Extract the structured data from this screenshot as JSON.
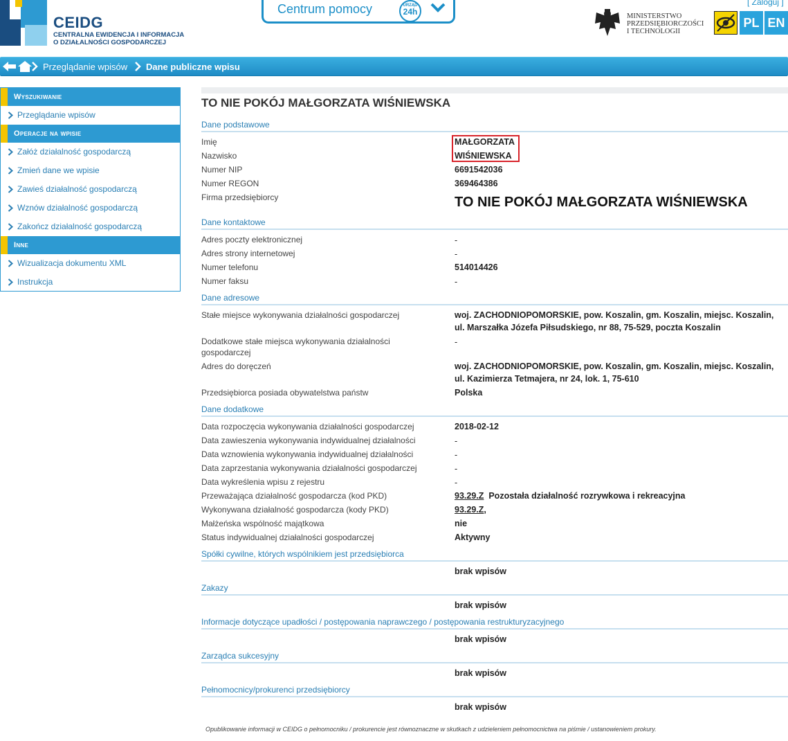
{
  "header": {
    "logo_title": "CEIDG",
    "logo_sub1": "CENTRALNA EWIDENCJA I INFORMACJA",
    "logo_sub2": "O DZIAŁALNOŚCI GOSPODARCZEJ",
    "help_label": "Centrum pomocy",
    "help_badge_top": "URZĄD",
    "help_badge_main": "24h",
    "login": "[ Zaloguj ]",
    "ministry_line1": "MINISTERSTWO",
    "ministry_line2": "PRZEDSIĘBIORCZOŚCI",
    "ministry_line3": "I TECHNOLOGII",
    "lang_pl": "PL",
    "lang_en": "EN"
  },
  "breadcrumb": {
    "item1": "Przeglądanie wpisów",
    "item2": "Dane publiczne wpisu"
  },
  "sidebar": {
    "head1": "Wyszukiwanie",
    "search_items": [
      "Przeglądanie wpisów"
    ],
    "head2": "Operacje na wpisie",
    "op_items": [
      "Załóż działalność gospodarczą",
      "Zmień dane we wpisie",
      "Zawieś działalność gospodarczą",
      "Wznów działalność gospodarczą",
      "Zakończ działalność gospodarczą"
    ],
    "head3": "Inne",
    "other_items": [
      "Wizualizacja dokumentu XML",
      "Instrukcja"
    ]
  },
  "entry": {
    "title": "TO NIE POKÓJ MAŁGORZATA WIŚNIEWSKA",
    "sections": {
      "basic": "Dane podstawowe",
      "contact": "Dane kontaktowe",
      "address": "Dane adresowe",
      "extra": "Dane dodatkowe",
      "partnerships": "Spółki cywilne, których wspólnikiem jest przedsiębiorca",
      "bans": "Zakazy",
      "bankruptcy": "Informacje dotyczące upadłości / postępowania naprawczego / postępowania restrukturyzacyjnego",
      "successor": "Zarządca sukcesyjny",
      "proxies": "Pełnomocnicy/prokurenci przedsiębiorcy"
    },
    "basic": {
      "imie_label": "Imię",
      "imie": "MAŁGORZATA",
      "nazwisko_label": "Nazwisko",
      "nazwisko": "WIŚNIEWSKA",
      "nip_label": "Numer NIP",
      "nip": "6691542036",
      "regon_label": "Numer REGON",
      "regon": "369464386",
      "firma_label": "Firma przedsiębiorcy",
      "firma": "TO NIE POKÓJ MAŁGORZATA WIŚNIEWSKA"
    },
    "contact": {
      "email_label": "Adres poczty elektronicznej",
      "email": "-",
      "www_label": "Adres strony internetowej",
      "www": "-",
      "phone_label": "Numer telefonu",
      "phone": "514014426",
      "fax_label": "Numer faksu",
      "fax": "-"
    },
    "address": {
      "main_label": "Stałe miejsce wykonywania działalności gospodarczej",
      "main_line1": "woj. ZACHODNIOPOMORSKIE, pow. Koszalin, gm. Koszalin, miejsc. Koszalin,",
      "main_line2": "ul. Marszałka Józefa Piłsudskiego, nr 88, 75-529, poczta Koszalin",
      "additional_label_1": "Dodatkowe stałe miejsca wykonywania działalności",
      "additional_label_2": "gospodarczej",
      "additional": "-",
      "delivery_label": "Adres do doręczeń",
      "delivery_line1": "woj. ZACHODNIOPOMORSKIE, pow. Koszalin, gm. Koszalin, miejsc. Koszalin,",
      "delivery_line2": "ul. Kazimierza Tetmajera, nr 24, lok. 1, 75-610",
      "citizenship_label": "Przedsiębiorca posiada obywatelstwa państw",
      "citizenship": "Polska"
    },
    "extra": {
      "start_label": "Data rozpoczęcia wykonywania działalności gospodarczej",
      "start": "2018-02-12",
      "suspend_label": "Data zawieszenia wykonywania indywidualnej działalności",
      "suspend": "-",
      "resume_label": "Data wznowienia wykonywania indywidualnej działalności",
      "resume": "-",
      "stop_label": "Data zaprzestania wykonywania działalności gospodarczej",
      "stop": "-",
      "removed_label": "Data wykreślenia wpisu z rejestru",
      "removed": "-",
      "pkd_main_label": "Przeważająca działalność gospodarcza (kod PKD)",
      "pkd_main_code": "93.29.Z",
      "pkd_main_desc": "Pozostała działalność rozrywkowa i rekreacyjna",
      "pkd_all_label": "Wykonywana działalność gospodarcza (kody PKD)",
      "pkd_all_code": "93.29.Z",
      "pkd_all_sep": ",",
      "marital_label": "Małżeńska wspólność majątkowa",
      "marital": "nie",
      "status_label": "Status indywidualnej działalności gospodarczej",
      "status": "Aktywny"
    },
    "empty_value": "brak wpisów",
    "footer_note": "Opublikowanie informacji w CEIDG o pełnomocniku / prokurencie jest równoznaczne w skutkach z udzieleniem pełnomocnictwa na piśmie / ustanowieniem prokury."
  }
}
